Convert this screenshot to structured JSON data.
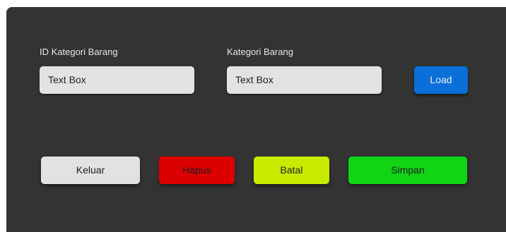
{
  "form": {
    "id_kategori": {
      "label": "ID Kategori Barang",
      "value": "Text Box"
    },
    "kategori": {
      "label": "Kategori Barang",
      "value": "Text Box"
    }
  },
  "buttons": {
    "load": {
      "label": "Load",
      "color": "#0a6fd8",
      "text_color": "#e8f0ff"
    },
    "keluar": {
      "label": "Keluar",
      "color": "#e2e2e2",
      "text_color": "#1f1f1f"
    },
    "hapus": {
      "label": "Hapus",
      "color": "#dd0000",
      "text_color": "#1e1e1e"
    },
    "batal": {
      "label": "Batal",
      "color": "#c8ea00",
      "text_color": "#1e1e1e"
    },
    "simpan": {
      "label": "Simpan",
      "color": "#10d414",
      "text_color": "#1e1e1e"
    }
  },
  "theme": {
    "panel_background": "#333333",
    "label_color": "#e6e6e6",
    "textbox_background": "#e2e2e2"
  }
}
